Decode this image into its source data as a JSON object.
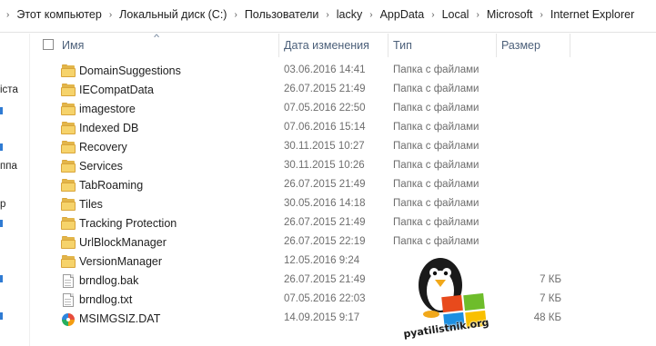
{
  "breadcrumbs": [
    "Этот компьютер",
    "Локальный диск (C:)",
    "Пользователи",
    "lacky",
    "AppData",
    "Local",
    "Microsoft",
    "Internet Explorer"
  ],
  "columns": {
    "name": "Имя",
    "date": "Дата изменения",
    "type": "Тип",
    "size": "Размер"
  },
  "nav_fragments": [
    "іста",
    "ппа",
    "р"
  ],
  "files": [
    {
      "name": "DomainSuggestions",
      "date": "03.06.2016 14:41",
      "type": "Папка с файлами",
      "size": "",
      "icon": "folder-icon"
    },
    {
      "name": "IECompatData",
      "date": "26.07.2015 21:49",
      "type": "Папка с файлами",
      "size": "",
      "icon": "folder-icon"
    },
    {
      "name": "imagestore",
      "date": "07.05.2016 22:50",
      "type": "Папка с файлами",
      "size": "",
      "icon": "folder-icon"
    },
    {
      "name": "Indexed DB",
      "date": "07.06.2016 15:14",
      "type": "Папка с файлами",
      "size": "",
      "icon": "folder-icon"
    },
    {
      "name": "Recovery",
      "date": "30.11.2015 10:27",
      "type": "Папка с файлами",
      "size": "",
      "icon": "folder-icon"
    },
    {
      "name": "Services",
      "date": "30.11.2015 10:26",
      "type": "Папка с файлами",
      "size": "",
      "icon": "folder-icon"
    },
    {
      "name": "TabRoaming",
      "date": "26.07.2015 21:49",
      "type": "Папка с файлами",
      "size": "",
      "icon": "folder-icon"
    },
    {
      "name": "Tiles",
      "date": "30.05.2016 14:18",
      "type": "Папка с файлами",
      "size": "",
      "icon": "folder-icon"
    },
    {
      "name": "Tracking Protection",
      "date": "26.07.2015 21:49",
      "type": "Папка с файлами",
      "size": "",
      "icon": "folder-icon"
    },
    {
      "name": "UrlBlockManager",
      "date": "26.07.2015 22:19",
      "type": "Папка с файлами",
      "size": "",
      "icon": "folder-icon"
    },
    {
      "name": "VersionManager",
      "date": "12.05.2016 9:24",
      "type": "",
      "size": "",
      "icon": "folder-icon"
    },
    {
      "name": "brndlog.bak",
      "date": "26.07.2015 21:49",
      "type": "",
      "size": "7 КБ",
      "icon": "file-icon"
    },
    {
      "name": "brndlog.txt",
      "date": "07.05.2016 22:03",
      "type": "",
      "size": "7 КБ",
      "icon": "file-icon"
    },
    {
      "name": "MSIMGSIZ.DAT",
      "date": "14.09.2015 9:17",
      "type": "",
      "size": "48 КБ",
      "icon": "dat-file-icon"
    }
  ],
  "watermark": {
    "text": "pyatilistnik.org"
  }
}
